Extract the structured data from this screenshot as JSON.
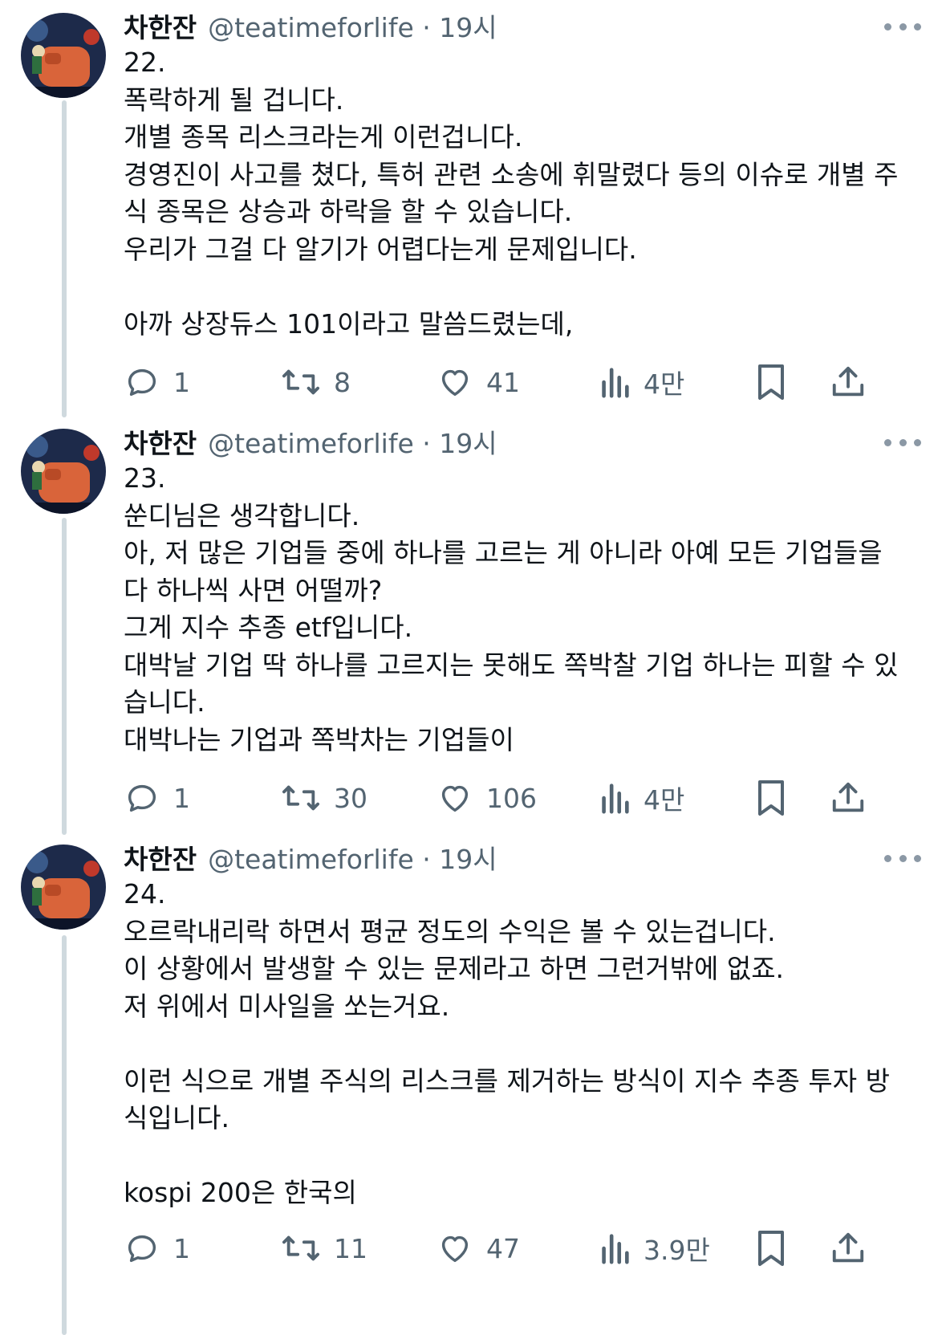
{
  "tweets": [
    {
      "author_name": "차한잔",
      "meta": "@teatimeforlife · 19시",
      "lines": [
        "22.",
        "폭락하게 될 겁니다.",
        "개별 종목 리스크라는게 이런겁니다.",
        "경영진이 사고를 쳤다, 특허 관련 소송에 휘말렸다 등의 이슈로 개별 주",
        "식 종목은 상승과 하락을 할 수 있습니다.",
        "우리가 그걸 다 알기가 어렵다는게 문제입니다.",
        "",
        "아까 상장듀스 101이라고 말씀드렸는데,"
      ],
      "replies": "1",
      "reposts": "8",
      "likes": "41",
      "views": "4만"
    },
    {
      "author_name": "차한잔",
      "meta": "@teatimeforlife · 19시",
      "lines": [
        "23.",
        "쑨디님은 생각합니다.",
        "아, 저 많은 기업들 중에 하나를 고르는 게 아니라 아예 모든 기업들을",
        "다 하나씩 사면 어떨까?",
        "그게 지수 추종 etf입니다.",
        "대박날 기업 딱 하나를 고르지는 못해도 쪽박찰 기업 하나는 피할 수 있",
        "습니다.",
        "대박나는 기업과 쪽박차는 기업들이"
      ],
      "replies": "1",
      "reposts": "30",
      "likes": "106",
      "views": "4만"
    },
    {
      "author_name": "차한잔",
      "meta": "@teatimeforlife · 19시",
      "lines": [
        "24.",
        "오르락내리락 하면서 평균 정도의 수익은 볼 수 있는겁니다.",
        "이 상황에서 발생할 수 있는 문제라고 하면 그런거밖에 없죠.",
        "저 위에서 미사일을 쏘는거요.",
        "",
        "이런 식으로 개별 주식의 리스크를 제거하는 방식이 지수 추종 투자 방",
        "식입니다.",
        "",
        "kospi 200은 한국의"
      ],
      "replies": "1",
      "reposts": "11",
      "likes": "47",
      "views": "3.9만"
    }
  ],
  "icons": {
    "reply": "reply-icon",
    "repost": "repost-icon",
    "like": "like-icon",
    "views": "views-icon",
    "bookmark": "bookmark-icon",
    "share": "share-icon",
    "more": "more-icon"
  },
  "colors": {
    "text": "#0f1419",
    "secondary": "#536471",
    "thread_line": "#cfd9de"
  }
}
